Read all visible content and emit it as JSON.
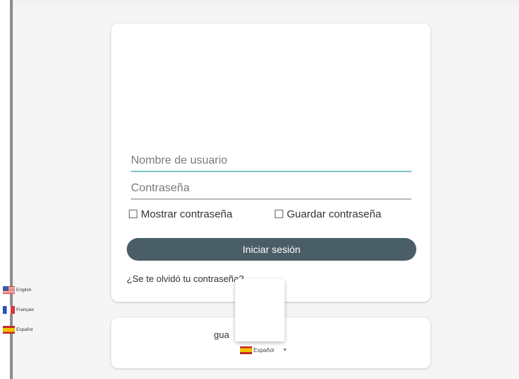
{
  "login_form": {
    "username_placeholder": "Nombre de usuario",
    "password_placeholder": "Contraseña",
    "show_password_label": "Mostrar contraseña",
    "save_password_label": "Guardar contraseña",
    "login_button_label": "Iniciar sesión",
    "forgot_password_link": "¿Se te olvidó tu contraseña?"
  },
  "language": {
    "title_visible_fragment": "gua",
    "selected_label": "Español",
    "selected_flag": "spain-flag-icon",
    "options": [
      {
        "label": "English",
        "flag": "usa-flag-icon"
      },
      {
        "label": "Français",
        "flag": "france-flag-icon"
      },
      {
        "label": "Español",
        "flag": "spain-flag-icon"
      }
    ]
  },
  "colors": {
    "button": "#4a5e68",
    "username_underline_focus": "#7ec5c1",
    "background": "#f5f5f5"
  }
}
